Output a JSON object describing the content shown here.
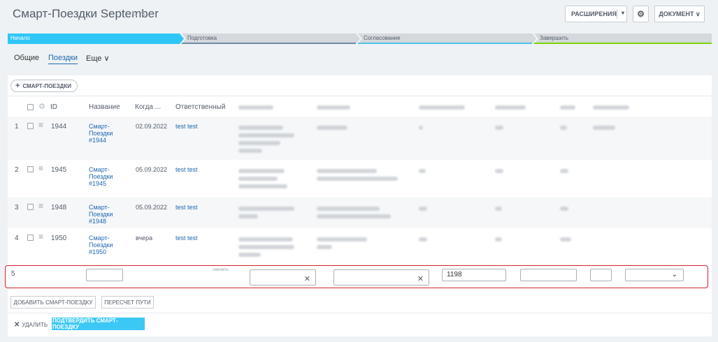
{
  "header": {
    "title": "Смарт-Поездки September",
    "extensions_label": "РАСШИРЕНИЯ",
    "document_label": "ДОКУМЕНТ ∨"
  },
  "stages": [
    {
      "label": "Начало",
      "color": "#2fc6f6"
    },
    {
      "label": "Подготовка",
      "color": "#d5d8dc"
    },
    {
      "label": "Согласование",
      "color": "#d5d8dc"
    },
    {
      "label": "Завершить",
      "color": "#d5d8dc"
    }
  ],
  "tabs": [
    {
      "label": "Общие"
    },
    {
      "label": "Поездки"
    },
    {
      "label": "Еще ∨"
    }
  ],
  "toolbar": {
    "add_smart_trip_label": "СМАРТ-ПОЕЗДКИ"
  },
  "table": {
    "columns": {
      "id": "ID",
      "name": "Название",
      "when": "Когда ...",
      "responsible": "Ответственный"
    },
    "rows": [
      {
        "num": "1",
        "id": "1944",
        "name_lines": [
          "Смарт-",
          "Поездки",
          "#1944"
        ],
        "when": "02.09.2022",
        "responsible": "test test"
      },
      {
        "num": "2",
        "id": "1945",
        "name_lines": [
          "Смарт-",
          "Поездки",
          "#1945"
        ],
        "when": "05.09.2022",
        "responsible": "test test"
      },
      {
        "num": "3",
        "id": "1948",
        "name_lines": [
          "Смарт-",
          "Поездки",
          "#1948"
        ],
        "when": "05.09.2022",
        "responsible": "test test"
      },
      {
        "num": "4",
        "id": "1950",
        "name_lines": [
          "Смарт-",
          "Поездки",
          "#1950"
        ],
        "when": "вчера",
        "responsible": "test test"
      }
    ]
  },
  "edit_row": {
    "num": "5",
    "change_label": "сменить",
    "number_value": "1198"
  },
  "footer": {
    "add_trip_label": "ДОБАВИТЬ СМАРТ-ПОЕЗДКУ",
    "recalc_label": "ПЕРЕСЧЕТ ПУТИ",
    "delete_label": "УДАЛИТЬ",
    "confirm_label": "ПОДТВЕРДИТЬ СМАРТ-ПОЕЗДКУ"
  },
  "icons": {
    "edit": "pencil-icon",
    "settings": "gear-icon",
    "plus": "plus-icon",
    "drag": "drag-handle-icon",
    "clear": "close-icon",
    "dropdown": "chevron-down-icon"
  },
  "colors": {
    "accent": "#2fc6f6",
    "link": "#2067b0",
    "error": "#d0262c",
    "primary_button": "#3bc8f5",
    "final_stage_underline": "#7bd500"
  }
}
